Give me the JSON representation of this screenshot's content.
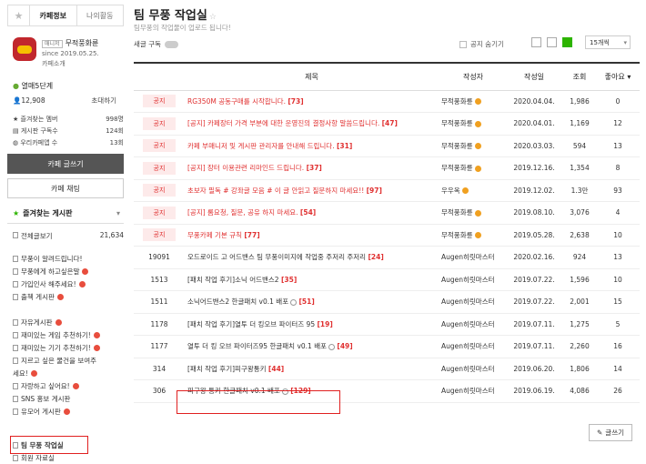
{
  "sidebar": {
    "tabs": [
      "카페정보",
      "나의활동"
    ],
    "profile": {
      "manager_badge": "매니저",
      "name": "무적풍화륜",
      "since": "since 2019.05.25.",
      "intro": "카페소개"
    },
    "level": "열매5단계",
    "members": "12,908",
    "invite": "초대하기",
    "meta": [
      {
        "label": "즐겨찾는 멤버",
        "value": "998명"
      },
      {
        "label": "게시판 구독수",
        "value": "124회"
      },
      {
        "label": "우리카페앱 수",
        "value": "13회"
      }
    ],
    "write_button": "카페 글쓰기",
    "chat_button": "카페 채팅",
    "fav_header": "즐겨찾는 게시판",
    "all_posts": {
      "label": "전체글보기",
      "count": "21,634"
    },
    "menu_group1": [
      {
        "label": "무풍이 알려드립니다!",
        "new": false
      },
      {
        "label": "무풍에게 하고싶은말",
        "new": true
      },
      {
        "label": "가입인사 해주세요!",
        "new": true
      },
      {
        "label": "출첵 게시판",
        "new": true
      }
    ],
    "menu_group2": [
      {
        "label": "자유게시판",
        "new": true
      },
      {
        "label": "재미있는 게임 추천하기!",
        "new": true
      },
      {
        "label": "재미있는 기기 추천하기!",
        "new": true
      },
      {
        "label": "지르고 싶은 물건을 보여주",
        "new": false
      },
      {
        "label": "세요!",
        "new": true
      },
      {
        "label": "자랑하고 싶어요!",
        "new": true
      },
      {
        "label": "SNS 홍보 게시판",
        "new": false
      },
      {
        "label": "유모어 게시판",
        "new": true
      }
    ],
    "menu_group3": [
      {
        "label": "팀 무풍 작업실",
        "new": false
      },
      {
        "label": "회원 자료실",
        "new": false
      }
    ]
  },
  "main": {
    "title": "팀 무풍 작업실",
    "subtitle": "팀무풍의 작업물이 업로드 됩니다!",
    "subscribe": "새글 구독",
    "hide_notice": "공지 숨기기",
    "per_page": "15개씩",
    "columns": [
      "제목",
      "작성자",
      "작성일",
      "조회",
      "좋아요"
    ],
    "notices": [
      {
        "badge": "공지",
        "title": "RG350M 공동구매를 시작합니다.",
        "comments": "[73]",
        "author": "무적풍화륜",
        "date": "2020.04.04.",
        "views": "1,986",
        "likes": "0"
      },
      {
        "badge": "공지",
        "title": "[공지] 카페장터 가격 부분에 대한 운영진의 결정사항 말씀드립니다.",
        "comments": "[47]",
        "author": "무적풍화륜",
        "date": "2020.04.01.",
        "views": "1,169",
        "likes": "12"
      },
      {
        "badge": "공지",
        "title": "카페 부매니저 및 게시판 관리자를 안내해 드립니다.",
        "comments": "[31]",
        "author": "무적풍화륜",
        "date": "2020.03.03.",
        "views": "594",
        "likes": "13"
      },
      {
        "badge": "공지",
        "title": "[공지] 장터 이용관련 리마인드 드립니다.",
        "comments": "[37]",
        "author": "무적풍화륜",
        "date": "2019.12.16.",
        "views": "1,354",
        "likes": "8"
      },
      {
        "badge": "공지",
        "title": "초보자 필독 # 강좌글 모음 # 이 글 안읽고 질문하지 마세요!!",
        "comments": "[97]",
        "author": "우우옥",
        "date": "2019.12.02.",
        "views": "1.3만",
        "likes": "93"
      },
      {
        "badge": "공지",
        "title": "[공지] 롬요청, 질문, 공유 하지 마세요.",
        "comments": "[54]",
        "author": "무적풍화륜",
        "date": "2019.08.10.",
        "views": "3,076",
        "likes": "4"
      },
      {
        "badge": "공지",
        "title": "무풍카페 기본 규칙",
        "comments": "[77]",
        "author": "무적풍화륜",
        "date": "2019.05.28.",
        "views": "2,638",
        "likes": "10"
      }
    ],
    "posts": [
      {
        "no": "19091",
        "title": "오드로이드 고 어드밴스 팀 무풍이미지에 작업중 주저리 주저리",
        "comments": "[24]",
        "author": "Augen히릿마스터",
        "date": "2020.02.16.",
        "views": "924",
        "likes": "13"
      },
      {
        "no": "1513",
        "title": "[패치 작업 후기]소닉 어드밴스2",
        "comments": "[35]",
        "author": "Augen히릿마스터",
        "date": "2019.07.22.",
        "views": "1,596",
        "likes": "10"
      },
      {
        "no": "1511",
        "title": "소닉어드밴스2 한글패치 v0.1 배포",
        "comments": "[51]",
        "author": "Augen히릿마스터",
        "date": "2019.07.22.",
        "views": "2,001",
        "likes": "15"
      },
      {
        "no": "1178",
        "title": "[패치 작업 후기]열투 더 킹오브 파이터즈 95",
        "comments": "[19]",
        "author": "Augen히릿마스터",
        "date": "2019.07.11.",
        "views": "1,275",
        "likes": "5"
      },
      {
        "no": "1177",
        "title": "열투 더 킹 오브 파이터즈95 한글패치 v0.1 배포",
        "comments": "[49]",
        "author": "Augen히릿마스터",
        "date": "2019.07.11.",
        "views": "2,260",
        "likes": "16"
      },
      {
        "no": "314",
        "title": "[패치 작업 후기]피구왕통키",
        "comments": "[44]",
        "author": "Augen히릿마스터",
        "date": "2019.06.20.",
        "views": "1,806",
        "likes": "14"
      },
      {
        "no": "306",
        "title": "피구왕 통키 한글패치 v0.1 배포",
        "comments": "[129]",
        "author": "Augen히릿마스터",
        "date": "2019.06.19.",
        "views": "4,086",
        "likes": "26"
      }
    ],
    "write_button": "글쓰기"
  }
}
